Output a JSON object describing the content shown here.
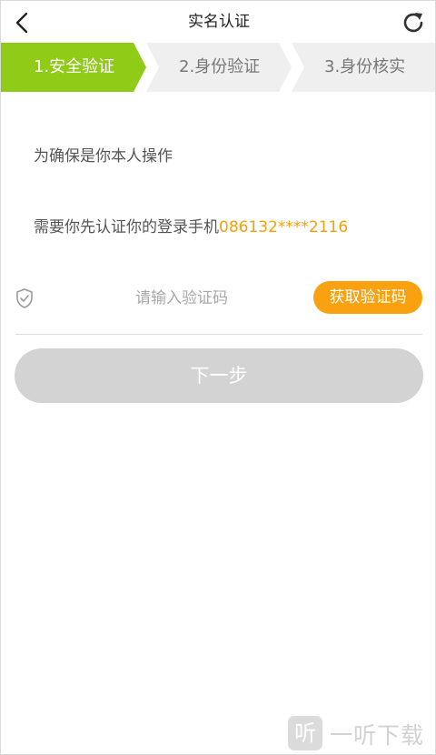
{
  "header": {
    "title": "实名认证",
    "back_icon": "chevron-left-icon",
    "refresh_icon": "refresh-icon"
  },
  "steps": [
    {
      "label": "1.安全验证",
      "active": true
    },
    {
      "label": "2.身份验证",
      "active": false
    },
    {
      "label": "3.身份核实",
      "active": false
    }
  ],
  "colors": {
    "step_active": "#8fcb17",
    "step_inactive": "#efefef",
    "accent": "#f9a10f",
    "disabled_button": "#d3d3d3"
  },
  "content": {
    "intro": "为确保是你本人操作",
    "phone_prefix": "需要你先认证你的登录手机",
    "phone_number": "086132****2116"
  },
  "form": {
    "code_placeholder": "请输入验证码",
    "code_value": "",
    "get_code_label": "获取验证码",
    "next_label": "下一步"
  },
  "watermark": {
    "logo_char": "听",
    "text": "一听下载"
  }
}
